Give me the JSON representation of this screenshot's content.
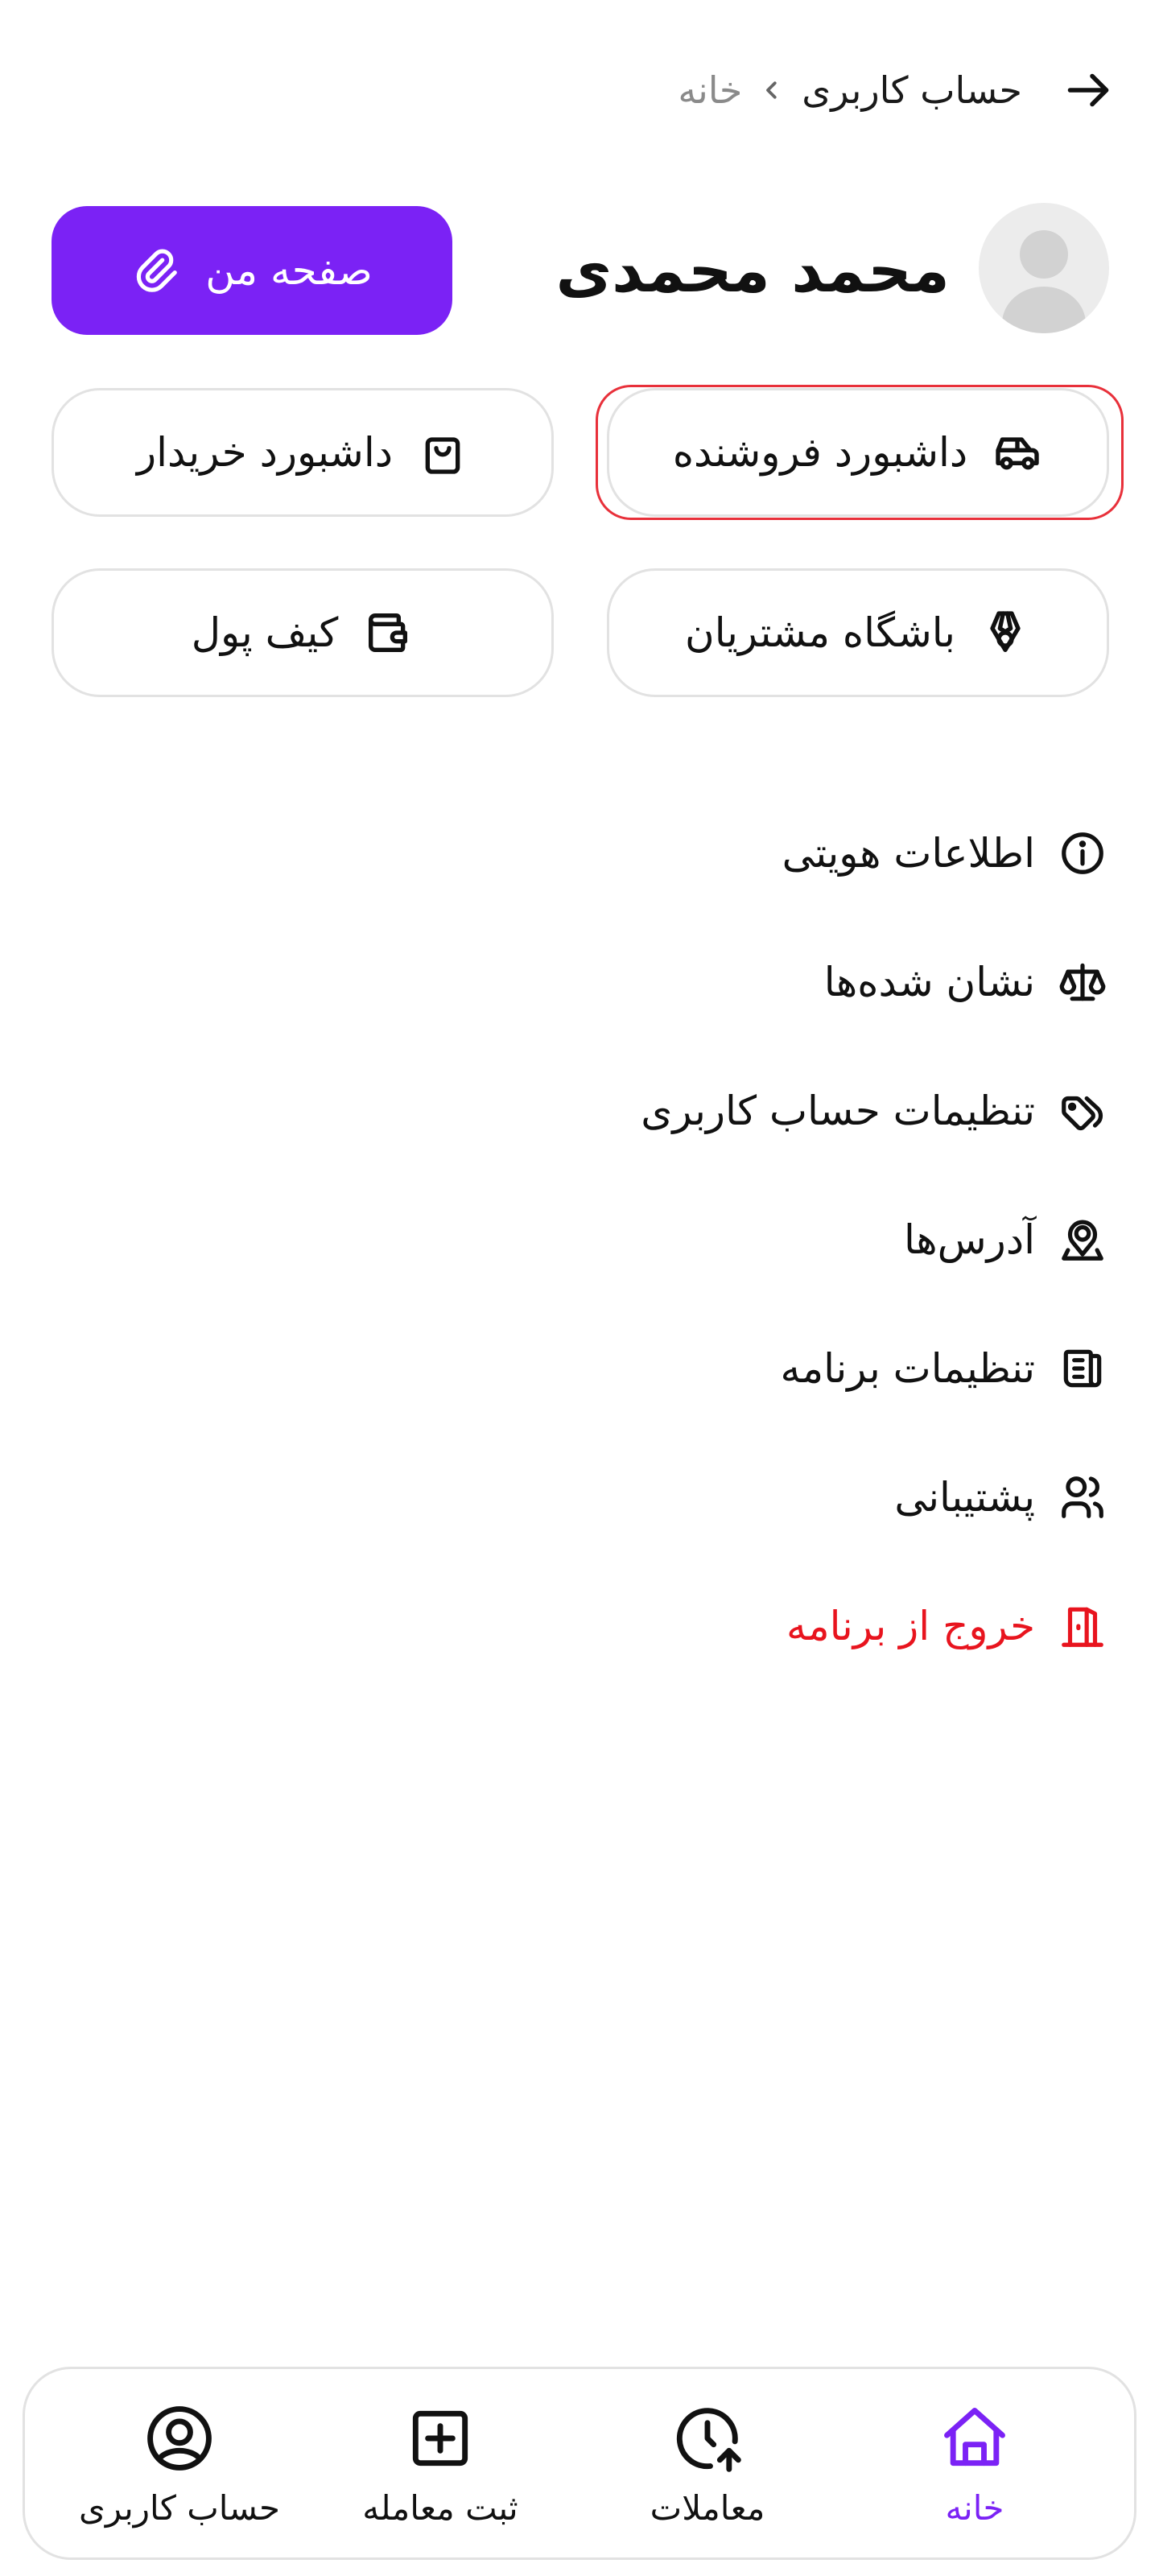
{
  "header": {
    "back_icon": "arrow-right-icon",
    "breadcrumb": {
      "home": "خانه",
      "separator_icon": "chevron-left-icon",
      "current": "حساب کاربری"
    }
  },
  "profile": {
    "avatar_icon": "user-avatar-icon",
    "name": "محمد محمدی",
    "my_page_button": {
      "label": "صفحه من",
      "icon": "paperclip-icon"
    }
  },
  "actions": [
    {
      "label": "داشبورد فروشنده",
      "icon": "car-icon"
    },
    {
      "label": "داشبورد خریدار",
      "icon": "shopping-bag-icon"
    },
    {
      "label": "باشگاه مشتریان",
      "icon": "medal-icon"
    },
    {
      "label": "کیف پول",
      "icon": "wallet-icon"
    }
  ],
  "menu": [
    {
      "label": "اطلاعات هویتی",
      "icon": "info-circle-icon"
    },
    {
      "label": "نشان شده‌ها",
      "icon": "scale-icon"
    },
    {
      "label": "تنظیمات حساب کاربری",
      "icon": "tags-icon"
    },
    {
      "label": "آدرس‌ها",
      "icon": "map-pin-icon"
    },
    {
      "label": "تنظیمات برنامه",
      "icon": "news-icon"
    },
    {
      "label": "پشتیبانی",
      "icon": "users-icon"
    },
    {
      "label": "خروج از برنامه",
      "icon": "door-exit-icon"
    }
  ],
  "bottom_nav": [
    {
      "label": "خانه",
      "icon": "home-icon",
      "active": true
    },
    {
      "label": "معاملات",
      "icon": "clock-arrow-icon",
      "active": false
    },
    {
      "label": "ثبت معامله",
      "icon": "plus-square-icon",
      "active": false
    },
    {
      "label": "حساب کاربری",
      "icon": "user-circle-icon",
      "active": false
    }
  ],
  "colors": {
    "accent": "#7b22f5",
    "logout": "#e8141e",
    "highlight_ring": "#e8303a",
    "border": "#e2e2e2"
  }
}
